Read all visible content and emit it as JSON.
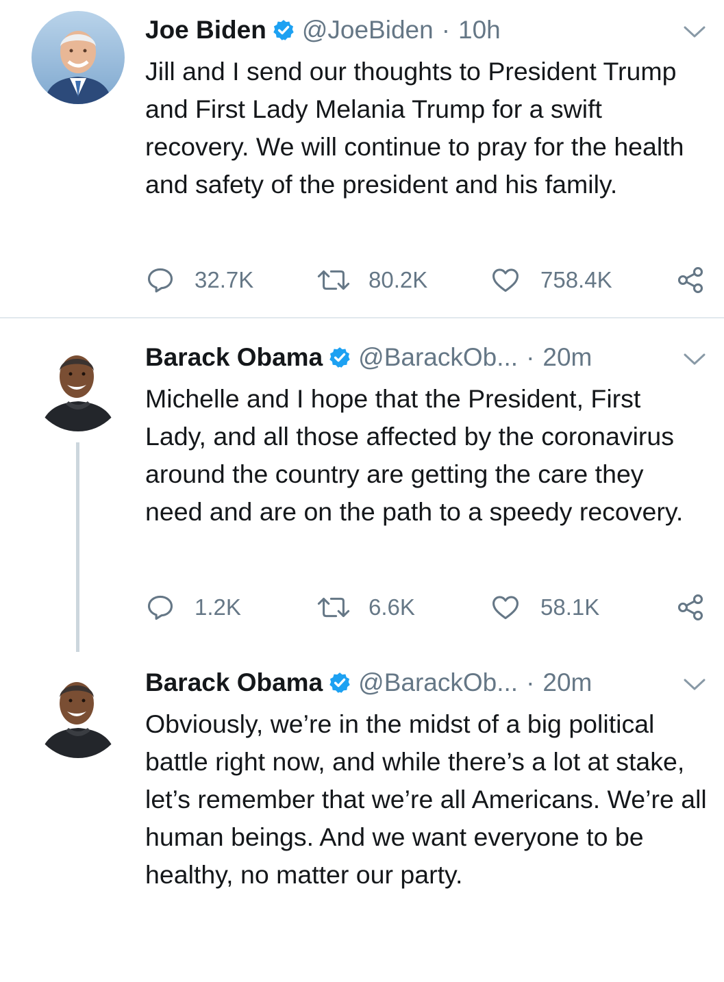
{
  "tweets": [
    {
      "name": "Joe Biden",
      "handle": "@JoeBiden",
      "separator": "·",
      "time": "10h",
      "text": "Jill and I send our thoughts to President Trump and First Lady Melania Trump for a swift recovery. We will continue to pray for the health and safety of the president and his family.",
      "replies": "32.7K",
      "retweets": "80.2K",
      "likes": "758.4K",
      "avatar_icon": "avatar-icon"
    },
    {
      "name": "Barack Obama",
      "handle": "@BarackOb...",
      "separator": "·",
      "time": "20m",
      "text": "Michelle and I hope that the President, First Lady, and all those affected by the coronavirus around the country are getting the care they need and are on the path to a speedy recovery.",
      "replies": "1.2K",
      "retweets": "6.6K",
      "likes": "58.1K",
      "avatar_icon": "avatar-icon"
    },
    {
      "name": "Barack Obama",
      "handle": "@BarackOb...",
      "separator": "·",
      "time": "20m",
      "text": "Obviously, we’re in the midst of a big political battle right now, and while there’s a lot at stake, let’s remember that we’re all Americans. We’re all human beings. And we want everyone to be healthy, no matter our party.",
      "avatar_icon": "avatar-icon"
    }
  ],
  "colors": {
    "verified": "#1da1f2",
    "secondary_text": "#657786",
    "divider": "#e1e8ed",
    "thread_line": "#ccd6dd"
  },
  "icons": {
    "verified": "verified-badge-icon",
    "menu": "chevron-down-icon",
    "reply": "reply-icon",
    "retweet": "retweet-icon",
    "like": "heart-icon",
    "share": "share-icon"
  }
}
